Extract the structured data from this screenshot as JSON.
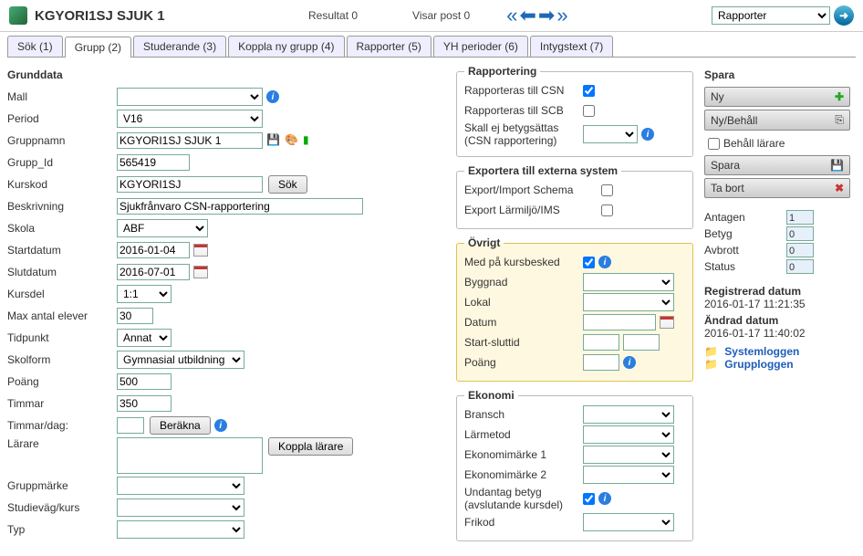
{
  "header": {
    "title": "KGYORI1SJ SJUK 1",
    "resultat": "Resultat 0",
    "visar": "Visar post 0",
    "report_select": "Rapporter"
  },
  "tabs": [
    {
      "label": "Sök (1)"
    },
    {
      "label": "Grupp (2)"
    },
    {
      "label": "Studerande (3)"
    },
    {
      "label": "Koppla ny grupp (4)"
    },
    {
      "label": "Rapporter (5)"
    },
    {
      "label": "YH perioder (6)"
    },
    {
      "label": "Intygstext (7)"
    }
  ],
  "grunddata": {
    "title": "Grunddata",
    "labels": {
      "mall": "Mall",
      "period": "Period",
      "gruppnamn": "Gruppnamn",
      "grupp_id": "Grupp_Id",
      "kurskod": "Kurskod",
      "beskrivning": "Beskrivning",
      "skola": "Skola",
      "startdatum": "Startdatum",
      "slutdatum": "Slutdatum",
      "kursdel": "Kursdel",
      "maxantal": "Max antal elever",
      "tidpunkt": "Tidpunkt",
      "skolform": "Skolform",
      "poang": "Poäng",
      "timmar": "Timmar",
      "timdag": "Timmar/dag:",
      "larare": "Lärare",
      "gruppmarke": "Gruppmärke",
      "studievag": "Studieväg/kurs",
      "typ": "Typ"
    },
    "values": {
      "mall": "",
      "period": "V16",
      "gruppnamn": "KGYORI1SJ SJUK 1",
      "grupp_id": "565419",
      "kurskod": "KGYORI1SJ",
      "beskrivning": "Sjukfrånvaro CSN-rapportering",
      "skola": "ABF",
      "startdatum": "2016-01-04",
      "slutdatum": "2016-07-01",
      "kursdel": "1:1",
      "maxantal": "30",
      "tidpunkt": "Annat",
      "skolform": "Gymnasial utbildning",
      "poang": "500",
      "timmar": "350",
      "timdag": "",
      "larare": ""
    },
    "buttons": {
      "sok": "Sök",
      "berakna": "Beräkna",
      "koppla": "Koppla lärare"
    }
  },
  "rapportering": {
    "title": "Rapportering",
    "csn": "Rapporteras till CSN",
    "scb": "Rapporteras till SCB",
    "skallej": "Skall ej betygsättas (CSN rapportering)"
  },
  "export": {
    "title": "Exportera till externa system",
    "schema": "Export/Import Schema",
    "larmiljo": "Export Lärmiljö/IMS"
  },
  "ovrigt": {
    "title": "Övrigt",
    "medpa": "Med på kursbesked",
    "byggnad": "Byggnad",
    "lokal": "Lokal",
    "datum": "Datum",
    "startslut": "Start-sluttid",
    "poang": "Poäng"
  },
  "ekonomi": {
    "title": "Ekonomi",
    "bransch": "Bransch",
    "larmetod": "Lärmetod",
    "eko1": "Ekonomimärke 1",
    "eko2": "Ekonomimärke 2",
    "undantag": "Undantag betyg (avslutande kursdel)",
    "frikod": "Frikod"
  },
  "spara": {
    "title": "Spara",
    "ny": "Ny",
    "nybehall": "Ny/Behåll",
    "behall_larare": "Behåll lärare",
    "spara": "Spara",
    "tabort": "Ta bort"
  },
  "stats": {
    "antagen": {
      "label": "Antagen",
      "val": "1"
    },
    "betyg": {
      "label": "Betyg",
      "val": "0"
    },
    "avbrott": {
      "label": "Avbrott",
      "val": "0"
    },
    "status": {
      "label": "Status",
      "val": "0"
    }
  },
  "dates": {
    "reg_title": "Registrerad datum",
    "reg_val": "2016-01-17 11:21:35",
    "chg_title": "Ändrad datum",
    "chg_val": "2016-01-17 11:40:02",
    "systemloggen": "Systemloggen",
    "grupploggen": "Grupploggen"
  }
}
